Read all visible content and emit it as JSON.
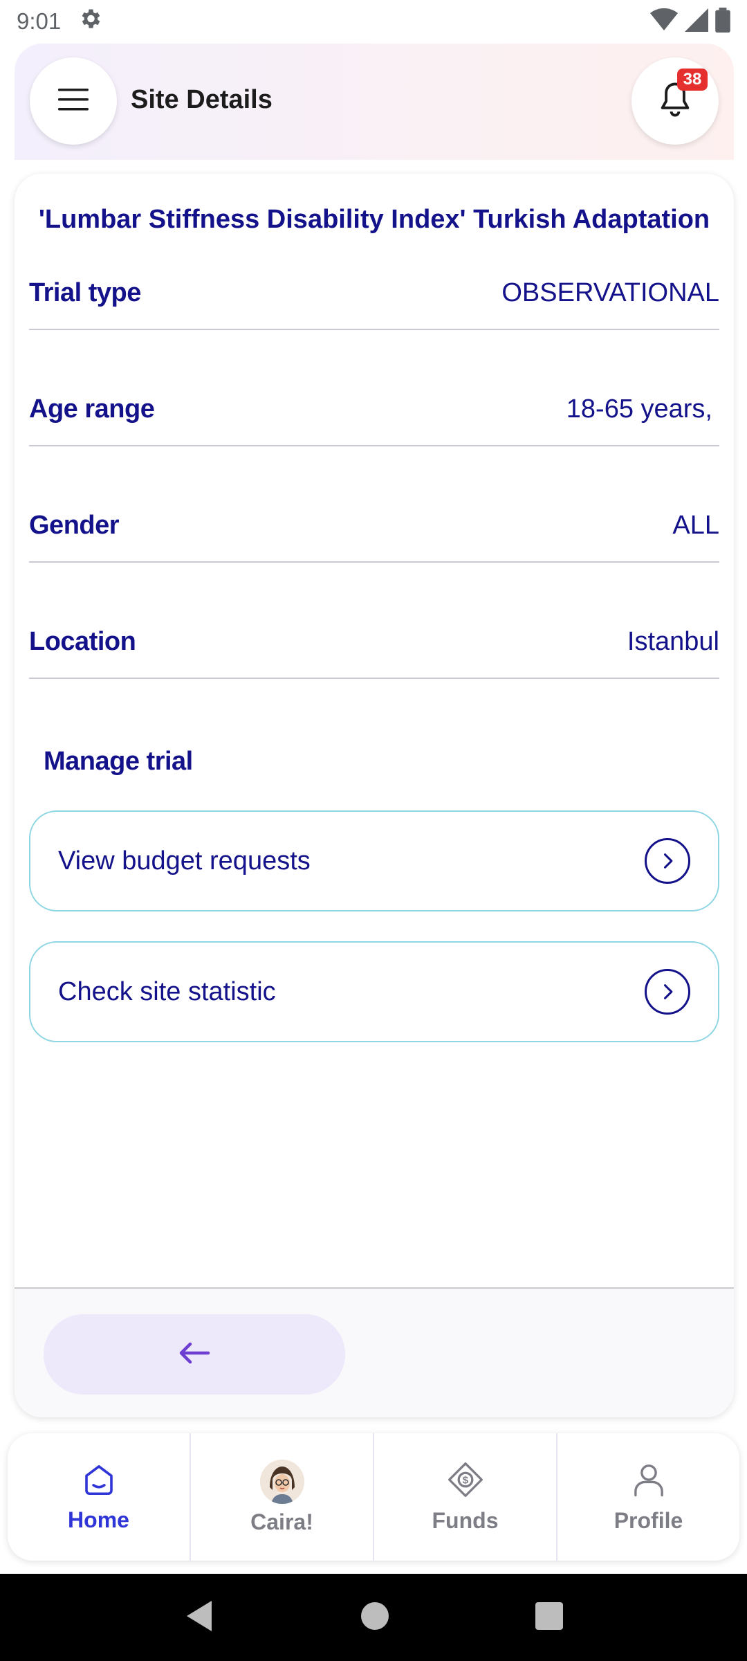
{
  "status_bar": {
    "time": "9:01"
  },
  "header": {
    "title": "Site Details",
    "notification_count": "38"
  },
  "trial": {
    "title": "'Lumbar Stiffness Disability Index' Turkish Adaptation",
    "details": [
      {
        "label": "Trial type",
        "value": "OBSERVATIONAL"
      },
      {
        "label": "Age range",
        "value": "18-65 years,"
      },
      {
        "label": "Gender",
        "value": "ALL"
      },
      {
        "label": "Location",
        "value": "Istanbul"
      }
    ]
  },
  "manage": {
    "heading": "Manage trial",
    "actions": [
      {
        "label": "View budget requests"
      },
      {
        "label": "Check site statistic"
      }
    ]
  },
  "bottom_nav": {
    "items": [
      {
        "label": "Home",
        "icon": "home-icon",
        "active": true
      },
      {
        "label": "Caira!",
        "icon": "assistant-avatar",
        "active": false
      },
      {
        "label": "Funds",
        "icon": "funds-icon",
        "active": false
      },
      {
        "label": "Profile",
        "icon": "profile-icon",
        "active": false
      }
    ]
  },
  "colors": {
    "primary_text": "#13128a",
    "accent_blue": "#2f35d6",
    "badge_red": "#e52f2f",
    "button_border": "#8fd6e3",
    "back_button_bg": "#ede8fa",
    "back_arrow": "#6c3fd1"
  }
}
